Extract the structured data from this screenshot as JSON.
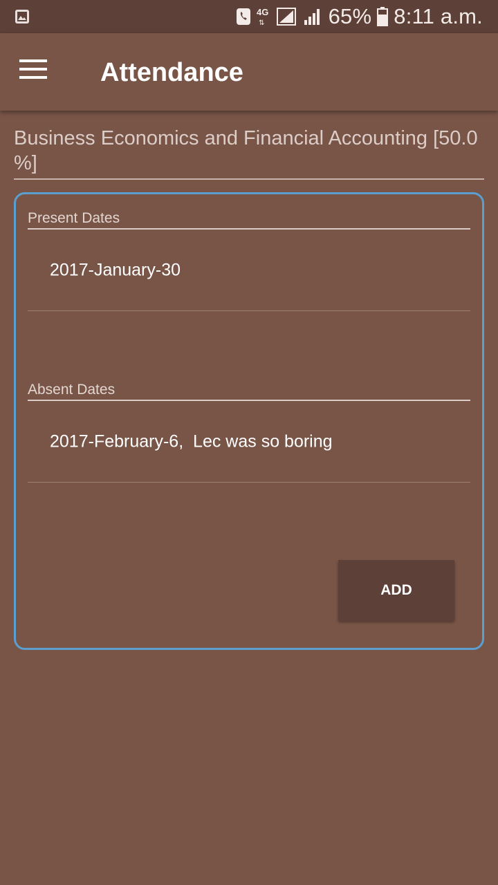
{
  "status_bar": {
    "network": "4G",
    "battery": "65%",
    "time": "8:11 a.m.",
    "icons": [
      "image-notification-icon",
      "phone-icon",
      "signal-4g-icon",
      "signal-icon",
      "battery-icon"
    ]
  },
  "app_bar": {
    "title": "Attendance",
    "menu_icon": "hamburger-menu-icon"
  },
  "subject": {
    "name": "Business Economics and Financial Accounting [50.0 %]"
  },
  "present": {
    "label": "Present Dates",
    "dates": [
      "2017-January-30"
    ]
  },
  "absent": {
    "label": "Absent Dates",
    "dates": [
      "2017-February-6,  Lec was so boring"
    ]
  },
  "actions": {
    "add_label": "ADD"
  },
  "colors": {
    "background": "#795548",
    "status_bar": "#5d4037",
    "button": "#5d4037",
    "card_border": "#5b9fd1"
  }
}
